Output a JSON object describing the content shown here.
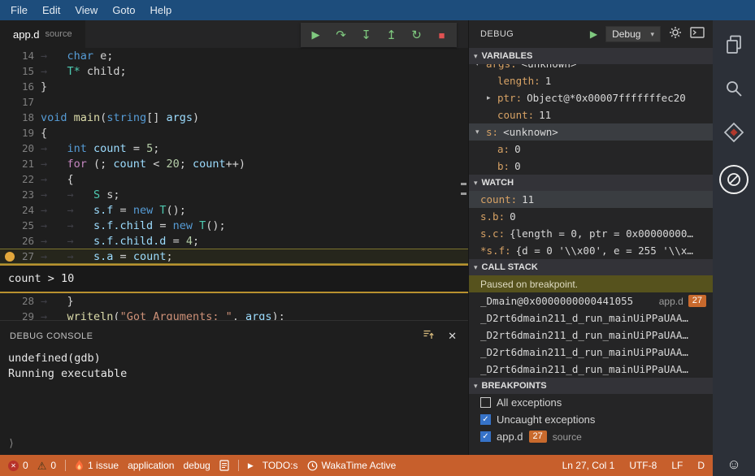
{
  "colors": {
    "menubar": "#1d4d7c",
    "statusbar": "#c75f2c",
    "badge": "#c96a2d",
    "breakpoint": "#e2a73c",
    "debug_icon_green": "#7fc97f",
    "stop_red": "#e05252",
    "check_blue": "#3672c7",
    "current_line_border": "#7d752e",
    "condition_border": "#b9912f"
  },
  "menubar": {
    "items": [
      "File",
      "Edit",
      "View",
      "Goto",
      "Help"
    ]
  },
  "tab": {
    "title": "app.d",
    "subtitle": "source"
  },
  "debug_toolbar": {
    "buttons": [
      {
        "name": "continue",
        "glyph": "▶"
      },
      {
        "name": "step-over",
        "glyph": "↷"
      },
      {
        "name": "step-into",
        "glyph": "↧"
      },
      {
        "name": "step-out",
        "glyph": "↥"
      },
      {
        "name": "restart",
        "glyph": "↻"
      },
      {
        "name": "stop",
        "glyph": "■"
      }
    ]
  },
  "editor": {
    "breakpoint_line": "27",
    "active_line": "27",
    "condition_after": "27",
    "condition": "count > 10",
    "lines": [
      {
        "num": "14",
        "tokens": [
          [
            "ws",
            "→   "
          ],
          [
            "kw",
            "char"
          ],
          [
            "pl",
            " e;"
          ]
        ]
      },
      {
        "num": "15",
        "tokens": [
          [
            "ws",
            "→   "
          ],
          [
            "type",
            "T*"
          ],
          [
            "pl",
            " child;"
          ]
        ]
      },
      {
        "num": "16",
        "tokens": [
          [
            "pl",
            "}"
          ]
        ]
      },
      {
        "num": "17",
        "tokens": []
      },
      {
        "num": "18",
        "tokens": [
          [
            "kw",
            "void"
          ],
          [
            "pl",
            " "
          ],
          [
            "fn",
            "main"
          ],
          [
            "pl",
            "("
          ],
          [
            "kw",
            "string"
          ],
          [
            "pl",
            "[] "
          ],
          [
            "var",
            "args"
          ],
          [
            "pl",
            ")"
          ]
        ]
      },
      {
        "num": "19",
        "tokens": [
          [
            "pl",
            "{"
          ]
        ]
      },
      {
        "num": "20",
        "tokens": [
          [
            "ws",
            "→   "
          ],
          [
            "kw",
            "int"
          ],
          [
            "pl",
            " "
          ],
          [
            "var",
            "count"
          ],
          [
            "pl",
            " = "
          ],
          [
            "num",
            "5"
          ],
          [
            "pl",
            ";"
          ]
        ]
      },
      {
        "num": "21",
        "tokens": [
          [
            "ws",
            "→   "
          ],
          [
            "ctrl",
            "for"
          ],
          [
            "pl",
            " (; "
          ],
          [
            "var",
            "count"
          ],
          [
            "pl",
            " < "
          ],
          [
            "num",
            "20"
          ],
          [
            "pl",
            "; "
          ],
          [
            "var",
            "count"
          ],
          [
            "pl",
            "++)"
          ]
        ]
      },
      {
        "num": "22",
        "tokens": [
          [
            "ws",
            "→   "
          ],
          [
            "pl",
            "{"
          ]
        ]
      },
      {
        "num": "23",
        "tokens": [
          [
            "ws",
            "→   →   "
          ],
          [
            "type",
            "S"
          ],
          [
            "pl",
            " s;"
          ]
        ]
      },
      {
        "num": "24",
        "tokens": [
          [
            "ws",
            "→   →   "
          ],
          [
            "var",
            "s.f"
          ],
          [
            "pl",
            " = "
          ],
          [
            "kw",
            "new"
          ],
          [
            "pl",
            " "
          ],
          [
            "type",
            "T"
          ],
          [
            "pl",
            "();"
          ]
        ]
      },
      {
        "num": "25",
        "tokens": [
          [
            "ws",
            "→   →   "
          ],
          [
            "var",
            "s.f.child"
          ],
          [
            "pl",
            " = "
          ],
          [
            "kw",
            "new"
          ],
          [
            "pl",
            " "
          ],
          [
            "type",
            "T"
          ],
          [
            "pl",
            "();"
          ]
        ]
      },
      {
        "num": "26",
        "tokens": [
          [
            "ws",
            "→   →   "
          ],
          [
            "var",
            "s.f.child.d"
          ],
          [
            "pl",
            " = "
          ],
          [
            "num",
            "4"
          ],
          [
            "pl",
            ";"
          ]
        ]
      },
      {
        "num": "27",
        "tokens": [
          [
            "ws",
            "→   →   "
          ],
          [
            "var",
            "s.a"
          ],
          [
            "pl",
            " = "
          ],
          [
            "var",
            "count"
          ],
          [
            "pl",
            ";"
          ]
        ]
      },
      {
        "num": "28",
        "tokens": [
          [
            "ws",
            "→   "
          ],
          [
            "pl",
            "}"
          ]
        ]
      },
      {
        "num": "29",
        "tokens": [
          [
            "ws",
            "→   "
          ],
          [
            "fn",
            "writeln"
          ],
          [
            "pl",
            "("
          ],
          [
            "str",
            "\"Got Arguments: \""
          ],
          [
            "pl",
            ", "
          ],
          [
            "var",
            "args"
          ],
          [
            "pl",
            ");"
          ]
        ]
      }
    ]
  },
  "console": {
    "title": "DEBUG CONSOLE",
    "lines": [
      "undefined(gdb)",
      "Running executable"
    ],
    "prompt": "⟩",
    "close_glyph": "✕"
  },
  "debug_panel": {
    "title": "DEBUG",
    "profile": "Debug",
    "start_glyph": "▶",
    "variables": {
      "title": "VARIABLES",
      "rows": [
        {
          "indent": 0,
          "twistie": "▾",
          "name": "args:",
          "value": "<unknown>",
          "partial": true
        },
        {
          "indent": 1,
          "name": "length:",
          "value": "1"
        },
        {
          "indent": 1,
          "twistie": "▸",
          "name": "ptr:",
          "value": "Object@*0x00007fffffffec20"
        },
        {
          "indent": 1,
          "name": "count:",
          "value": "11"
        },
        {
          "indent": 0,
          "twistie": "▾",
          "name": "s:",
          "value": "<unknown>",
          "selected": true
        },
        {
          "indent": 1,
          "name": "a:",
          "value": "0"
        },
        {
          "indent": 1,
          "name": "b:",
          "value": "0"
        }
      ]
    },
    "watch": {
      "title": "WATCH",
      "rows": [
        {
          "name": "count:",
          "value": "11",
          "selected": true
        },
        {
          "name": "s.b:",
          "value": "0"
        },
        {
          "name": "s.c:",
          "value": "{length = 0, ptr = 0x00000000…"
        },
        {
          "name": "*s.f:",
          "value": "{d = 0 '\\\\x00', e = 255 '\\\\x…"
        }
      ]
    },
    "call_stack": {
      "title": "CALL STACK",
      "status": "Paused on breakpoint.",
      "frames": [
        {
          "name": "_Dmain@0x0000000000441055",
          "file": "app.d",
          "line": "27"
        },
        {
          "name": "_D2rt6dmain211_d_run_mainUiPPaUAA…"
        },
        {
          "name": "_D2rt6dmain211_d_run_mainUiPPaUAA…"
        },
        {
          "name": "_D2rt6dmain211_d_run_mainUiPPaUAA…"
        },
        {
          "name": "_D2rt6dmain211_d_run_mainUiPPaUAA…"
        }
      ]
    },
    "breakpoints": {
      "title": "BREAKPOINTS",
      "rows": [
        {
          "checked": false,
          "label": "All exceptions"
        },
        {
          "checked": true,
          "label": "Uncaught exceptions"
        },
        {
          "checked": true,
          "label": "app.d",
          "badge": "27",
          "hint": "source"
        }
      ]
    }
  },
  "statusbar": {
    "errors": "0",
    "warnings": "0",
    "issue": "1 issue",
    "app_label": "application",
    "debug_label": "debug",
    "play": "▶",
    "todo": "TODO:s",
    "wakatime": "WakaTime Active",
    "line_col": "Ln 27, Col 1",
    "encoding": "UTF-8",
    "eol": "LF",
    "lang": "D",
    "smiley": "☺"
  }
}
